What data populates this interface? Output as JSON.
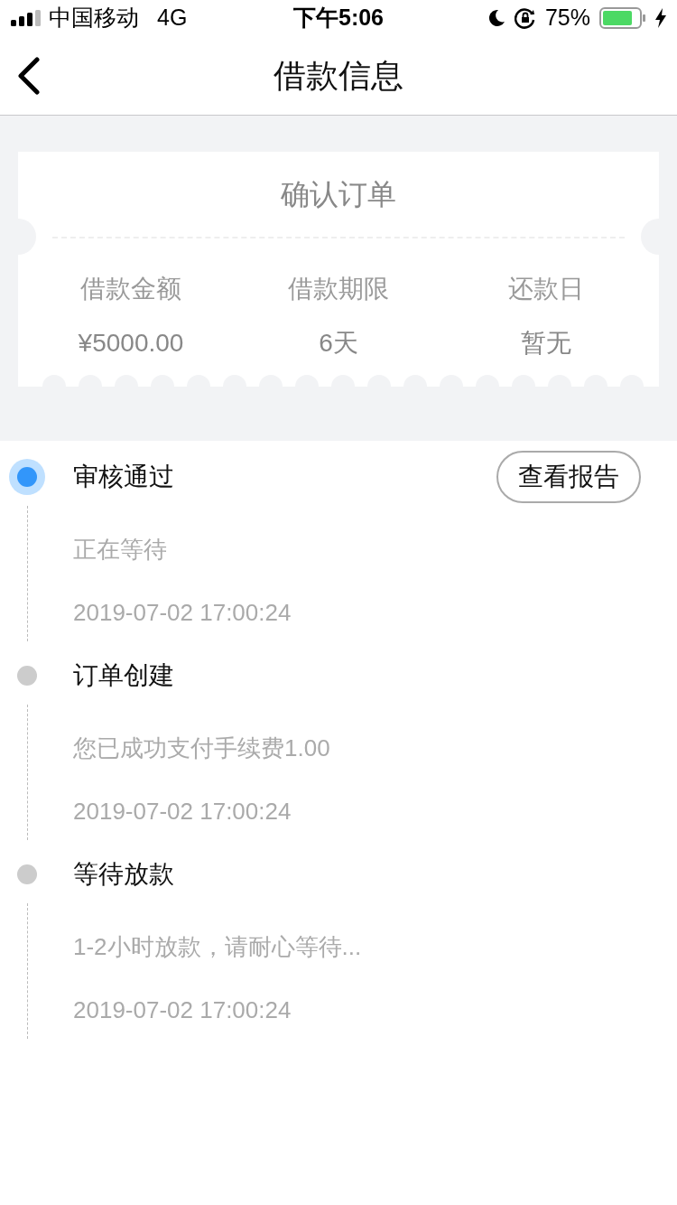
{
  "status_bar": {
    "carrier": "中国移动",
    "network": "4G",
    "time": "下午5:06",
    "battery": "75%"
  },
  "nav": {
    "title": "借款信息"
  },
  "order_card": {
    "title": "确认订单",
    "fields": [
      {
        "label": "借款金额",
        "value": "¥5000.00"
      },
      {
        "label": "借款期限",
        "value": "6天"
      },
      {
        "label": "还款日",
        "value": "暂无"
      }
    ]
  },
  "timeline": [
    {
      "title": "审核通过",
      "active": true,
      "button": "查看报告",
      "description": "正在等待",
      "time": "2019-07-02 17:00:24"
    },
    {
      "title": "订单创建",
      "active": false,
      "description": "您已成功支付手续费1.00",
      "time": "2019-07-02 17:00:24"
    },
    {
      "title": "等待放款",
      "active": false,
      "description": "1-2小时放款，请耐心等待...",
      "time": "2019-07-02 17:00:24"
    }
  ]
}
